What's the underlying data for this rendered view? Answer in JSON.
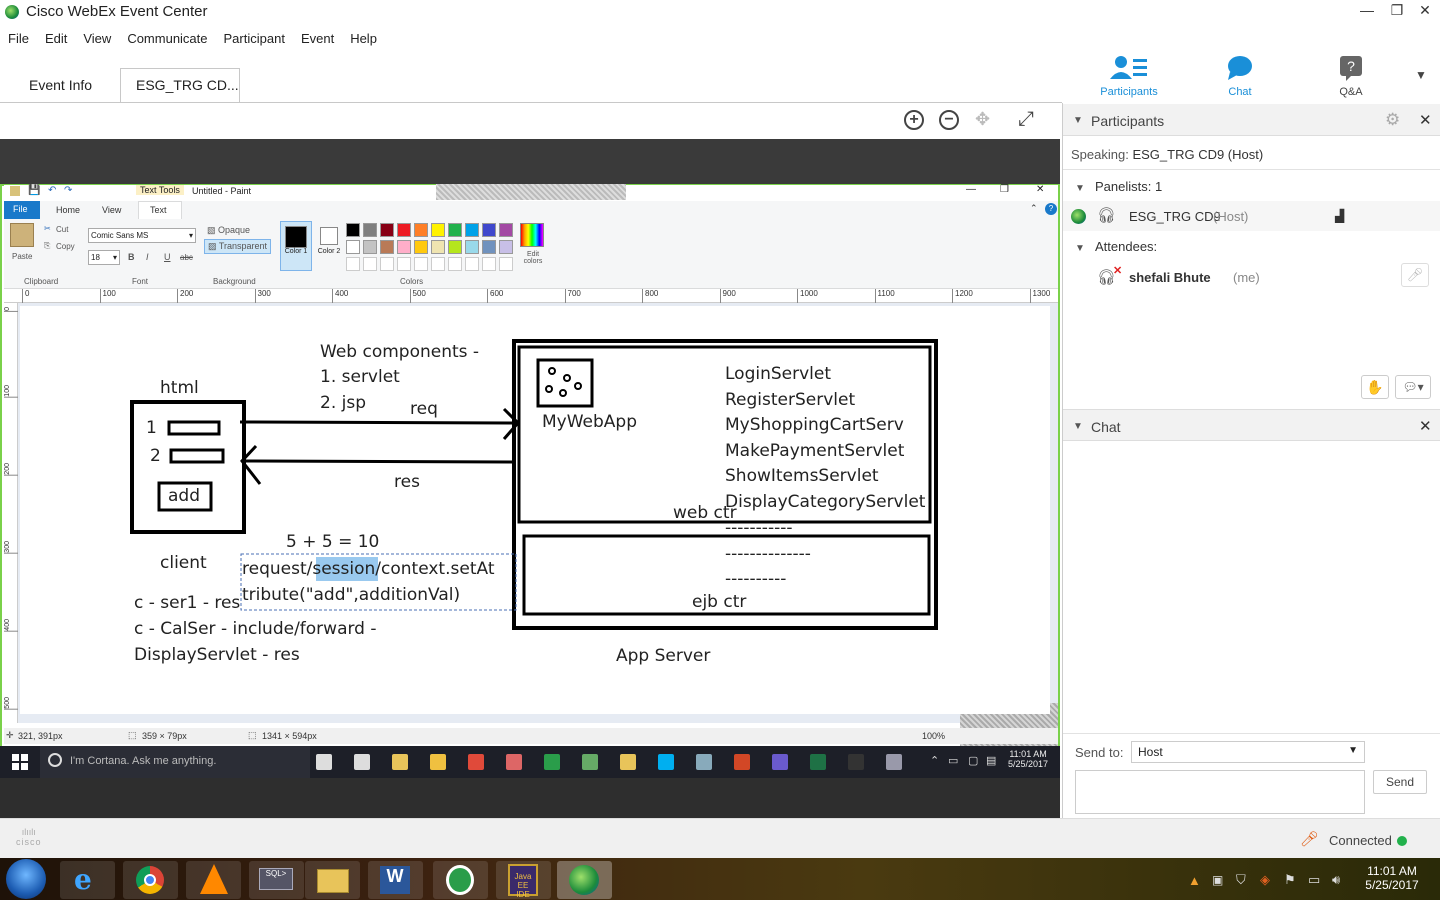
{
  "window": {
    "title": "Cisco WebEx Event Center"
  },
  "menu": [
    "File",
    "Edit",
    "View",
    "Communicate",
    "Participant",
    "Event",
    "Help"
  ],
  "tabs": [
    {
      "label": "Event Info"
    },
    {
      "label": "ESG_TRG CD..."
    }
  ],
  "top_icons": [
    {
      "label": "Participants",
      "icon": "participants-icon"
    },
    {
      "label": "Chat",
      "icon": "chat-icon"
    },
    {
      "label": "Q&A",
      "icon": "qa-icon"
    }
  ],
  "paint": {
    "title": "Untitled - Paint",
    "context_tab": "Text Tools",
    "tabs": [
      "File",
      "Home",
      "View",
      "Text"
    ],
    "clipboard": {
      "paste": "Paste",
      "cut": "Cut",
      "copy": "Copy",
      "group": "Clipboard"
    },
    "font": {
      "family": "Comic Sans MS",
      "size": "18",
      "group": "Font"
    },
    "background": {
      "opaque": "Opaque",
      "transparent": "Transparent",
      "group": "Background"
    },
    "colors": {
      "color1": "Color 1",
      "color2": "Color 2",
      "edit": "Edit colors",
      "group": "Colors"
    },
    "palette": [
      "#000000",
      "#7f7f7f",
      "#880015",
      "#ed1c24",
      "#ff7f27",
      "#fff200",
      "#22b14c",
      "#00a2e8",
      "#3f48cc",
      "#a349a4",
      "#ffffff",
      "#c3c3c3",
      "#b97a57",
      "#ffaec9",
      "#ffc90e",
      "#efe4b0",
      "#b5e61d",
      "#99d9ea",
      "#7092be",
      "#c8bfe7"
    ],
    "ruler_ticks": [
      "0",
      "100",
      "200",
      "300",
      "400",
      "500",
      "600",
      "700",
      "800",
      "900",
      "1000",
      "1100",
      "1200",
      "1300"
    ],
    "left_ruler_ticks": [
      "0",
      "100",
      "200",
      "300",
      "400",
      "500"
    ],
    "status": {
      "cursor": "321, 391px",
      "selection": "359 × 79px",
      "canvas": "1341 × 594px",
      "zoom": "100%"
    }
  },
  "drawing": {
    "web_components": "Web components -",
    "servlet": "1. servlet",
    "jsp": "2. jsp",
    "html_label": "html",
    "row1": "1",
    "row2": "2",
    "add_btn": "add",
    "req": "req",
    "res": "res",
    "client": "client",
    "app_name": "MyWebApp",
    "servlets": [
      "LoginServlet",
      "RegisterServlet",
      "MyShoppingCartServ",
      "MakePaymentServlet",
      "ShowItemsServlet",
      "DisplayCategoryServlet"
    ],
    "web_ctr": "web ctr",
    "dashes": [
      "-----------",
      "--------------",
      "----------"
    ],
    "ejb_ctr": "ejb ctr",
    "app_server": "App Server",
    "sum": "5 + 5 = 10",
    "text_line1_a": "request/",
    "text_line1_sel": "session",
    "text_line1_b": "/context.setAt",
    "text_line2": "tribute(\"add\",additionVal)",
    "notes": [
      "c - ser1 - res",
      "c - CalSer - include/forward -",
      "DisplayServlet - res"
    ]
  },
  "inner_taskbar": {
    "cortana": "I'm Cortana. Ask me anything.",
    "time": "11:01 AM",
    "date": "5/25/2017"
  },
  "participants_panel": {
    "title": "Participants",
    "speaking_label": "Speaking:",
    "speaking_name": "ESG_TRG CD9 (Host)",
    "panelists": "Panelists: 1",
    "panelist_name": "ESG_TRG CD9",
    "panelist_role": "(Host)",
    "attendees": "Attendees:",
    "attendee_name": "shefali Bhute",
    "attendee_me": "(me)"
  },
  "chat_panel": {
    "title": "Chat",
    "send_to_label": "Send to:",
    "send_to_value": "Host",
    "send_button": "Send"
  },
  "footer": {
    "logo": "cisco",
    "status": "Connected",
    "status_color": "#22b14c"
  },
  "system_tray": {
    "time": "11:01 AM",
    "date": "5/25/2017"
  }
}
